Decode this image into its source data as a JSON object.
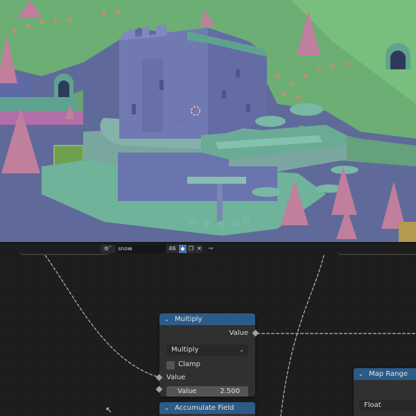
{
  "viewport": {
    "colors": {
      "ground": "#5f6a9a",
      "grass": "#6cae74",
      "building": "#7179b3",
      "roof": "#5fa38f",
      "trees": "#c07f9c"
    }
  },
  "header": {
    "editor_type_icon": "node-editor-icon",
    "node_tree_name": "snow",
    "user_count": "46",
    "icons": [
      "fake-user-shield-icon",
      "duplicate-icon",
      "close-icon",
      "pin-icon"
    ]
  },
  "nodes": {
    "multiply": {
      "title": "Multiply",
      "output_label": "Value",
      "operation": "Multiply",
      "clamp_label": "Clamp",
      "input_label": "Value",
      "value_label": "Value",
      "value": "2.500"
    },
    "accumulate_field": {
      "title": "Accumulate Field"
    },
    "map_range": {
      "title": "Map Range",
      "data_type": "Float"
    }
  }
}
